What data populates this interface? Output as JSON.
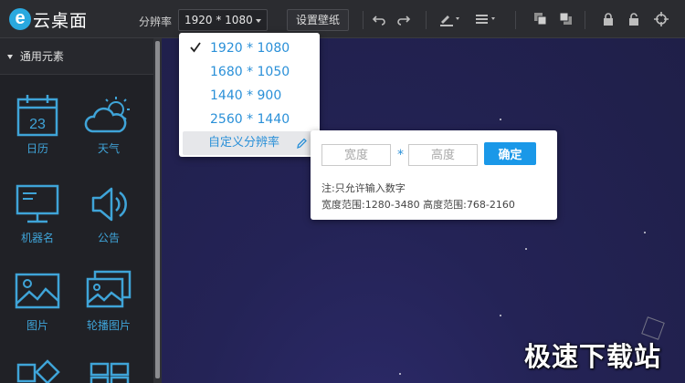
{
  "app": {
    "logo_letter": "e",
    "logo_text": "云桌面"
  },
  "toolbar": {
    "resolution_label": "分辨率",
    "resolution_value": "1920 * 1080",
    "wallpaper_button": "设置壁纸",
    "icons": [
      "undo-icon",
      "redo-icon",
      "pen-color-icon",
      "line-style-icon",
      "bring-forward-icon",
      "send-backward-icon",
      "lock-icon",
      "unlock-icon",
      "target-icon"
    ]
  },
  "sidebar": {
    "section_title": "通用元素",
    "widgets": [
      {
        "label": "日历",
        "icon": "calendar-icon",
        "day": "23"
      },
      {
        "label": "天气",
        "icon": "weather-icon"
      },
      {
        "label": "机器名",
        "icon": "monitor-icon"
      },
      {
        "label": "公告",
        "icon": "speaker-icon"
      },
      {
        "label": "图片",
        "icon": "image-icon"
      },
      {
        "label": "轮播图片",
        "icon": "carousel-icon"
      }
    ]
  },
  "dropdown": {
    "items": [
      {
        "label": "1920 * 1080",
        "selected": true
      },
      {
        "label": "1680 * 1050",
        "selected": false
      },
      {
        "label": "1440 * 900",
        "selected": false
      },
      {
        "label": "2560 * 1440",
        "selected": false
      }
    ],
    "custom_label": "自定义分辨率"
  },
  "custom_popup": {
    "width_placeholder": "宽度",
    "height_placeholder": "高度",
    "separator": "*",
    "confirm_button": "确定",
    "note_1": "注:只允许输入数字",
    "note_2": "宽度范围:1280-3480 高度范围:768-2160"
  },
  "watermark": "极速下载站",
  "colors": {
    "accent": "#2a90d8",
    "button": "#1a98e8",
    "sidebar_icon": "#3fa4d8",
    "canvas": "#242356"
  }
}
